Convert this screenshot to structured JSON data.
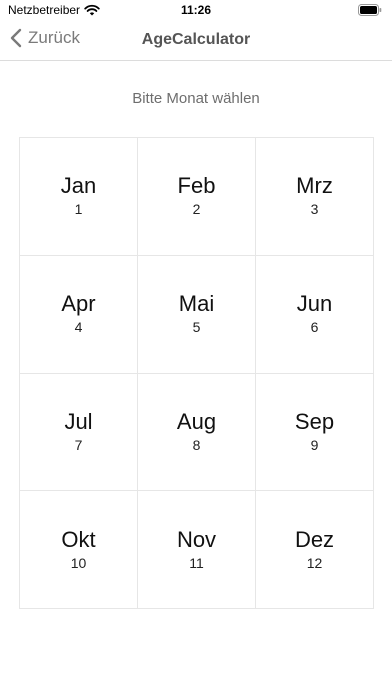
{
  "status_bar": {
    "carrier": "Netzbetreiber",
    "time": "11:26",
    "icons": [
      "wifi-icon",
      "battery-icon"
    ]
  },
  "nav": {
    "back_label": "Zurück",
    "title": "AgeCalculator",
    "back_icon": "chevron-left-icon"
  },
  "prompt": "Bitte Monat wählen",
  "months": [
    {
      "name": "Jan",
      "number": "1"
    },
    {
      "name": "Feb",
      "number": "2"
    },
    {
      "name": "Mrz",
      "number": "3"
    },
    {
      "name": "Apr",
      "number": "4"
    },
    {
      "name": "Mai",
      "number": "5"
    },
    {
      "name": "Jun",
      "number": "6"
    },
    {
      "name": "Jul",
      "number": "7"
    },
    {
      "name": "Aug",
      "number": "8"
    },
    {
      "name": "Sep",
      "number": "9"
    },
    {
      "name": "Okt",
      "number": "10"
    },
    {
      "name": "Nov",
      "number": "11"
    },
    {
      "name": "Dez",
      "number": "12"
    }
  ],
  "colors": {
    "nav_text": "#7a7a7a",
    "grid_line": "#e6e6e6",
    "prompt_text": "#6e6e6e"
  }
}
